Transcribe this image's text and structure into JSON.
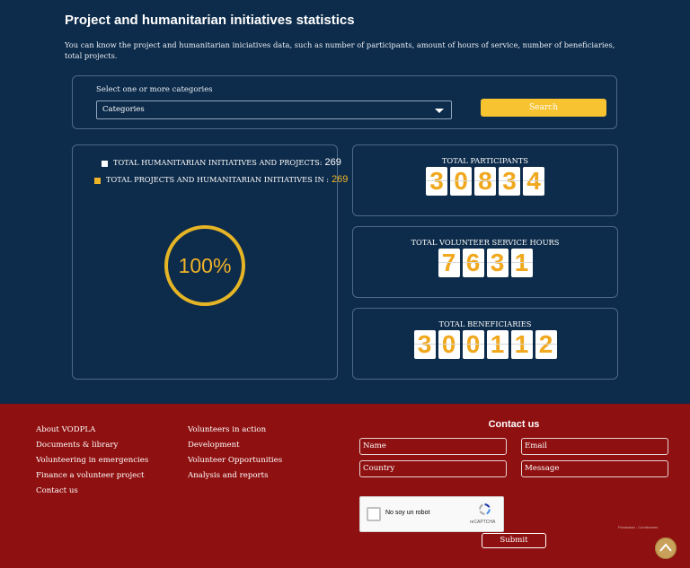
{
  "header": {
    "title": "Project and humanitarian initiatives statistics",
    "description": "You can know the project and humanitarian iniciatives data, such as number of participants, amount of hours of service, number of beneficiaries, total projects."
  },
  "filter": {
    "label": "Select one or more categories",
    "select_value": "Categories",
    "search_label": "Search"
  },
  "summary": {
    "total_label": "TOTAL HUMANITARIAN INITIATIVES AND PROJECTS:",
    "total_value": "269",
    "filtered_label": "TOTAL PROJECTS AND HUMANITARIAN INITIATIVES IN :",
    "filtered_value": "269",
    "percent_label": "100%",
    "percent": 100
  },
  "stats": {
    "participants": {
      "title": "TOTAL PARTICIPANTS",
      "digits": [
        "3",
        "0",
        "8",
        "3",
        "4"
      ]
    },
    "hours": {
      "title": "TOTAL VOLUNTEER SERVICE HOURS",
      "digits": [
        "7",
        "6",
        "3",
        "1"
      ]
    },
    "beneficiaries": {
      "title": "TOTAL BENEFICIARIES",
      "digits": [
        "3",
        "0",
        "0",
        "1",
        "1",
        "2"
      ]
    }
  },
  "footer": {
    "col1": [
      "About VODPLA",
      "Documents & library",
      "Volunteering in emergencies",
      "Finance a volunteer project",
      "Contact us"
    ],
    "col2": [
      "Volunteers in action",
      "Development",
      "Volunteer Opportunities",
      "Analysis and reports"
    ],
    "contact_title": "Contact us",
    "fields": {
      "name": "Name",
      "email": "Email",
      "country": "Country",
      "message": "Message"
    },
    "captcha_label": "No soy un robot",
    "captcha_brand": "reCAPTCHA",
    "submit_label": "Submit",
    "fine_print": "Privacidad - Condiciones"
  },
  "colors": {
    "background": "#0d2b4a",
    "accent": "#f0b429",
    "footer": "#8f1010"
  }
}
